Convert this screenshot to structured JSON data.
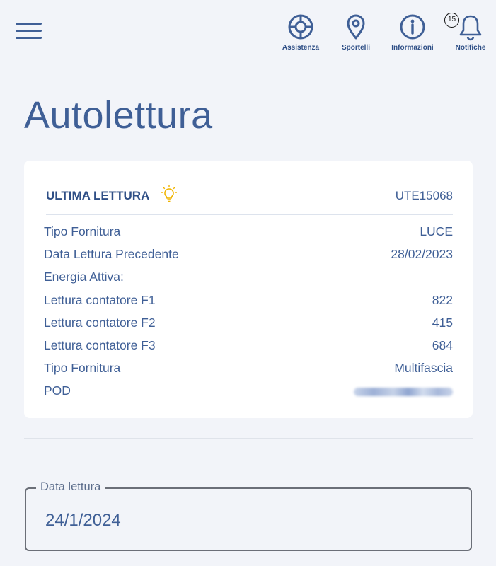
{
  "header": {
    "nav": [
      {
        "id": "assistenza",
        "label": "Assistenza",
        "icon": "lifebuoy-icon"
      },
      {
        "id": "sportelli",
        "label": "Sportelli",
        "icon": "map-pin-icon"
      },
      {
        "id": "informazioni",
        "label": "Informazioni",
        "icon": "info-icon"
      },
      {
        "id": "notifiche",
        "label": "Notifiche",
        "icon": "bell-icon"
      }
    ],
    "notifications_count": "15"
  },
  "page": {
    "title": "Autolettura"
  },
  "card": {
    "title": "ULTIMA LETTURA",
    "title_icon": "lightbulb-icon",
    "code": "UTE15068",
    "rows": [
      {
        "label": "Tipo Fornitura",
        "value": "LUCE"
      },
      {
        "label": "Data Lettura Precedente",
        "value": "28/02/2023"
      },
      {
        "label": "Energia Attiva:",
        "value": ""
      },
      {
        "label": "Lettura contatore F1",
        "value": "822"
      },
      {
        "label": "Lettura contatore F2",
        "value": "415"
      },
      {
        "label": "Lettura contatore F3",
        "value": "684"
      },
      {
        "label": "Tipo Fornitura",
        "value": "Multifascia"
      },
      {
        "label": "POD",
        "value": ""
      }
    ]
  },
  "form": {
    "data_lettura": {
      "label": "Data lettura",
      "value": "24/1/2024"
    }
  },
  "colors": {
    "primary": "#3f5f96",
    "background": "#f2f4f9",
    "card": "#ffffff",
    "bulb": "#f0b400"
  }
}
